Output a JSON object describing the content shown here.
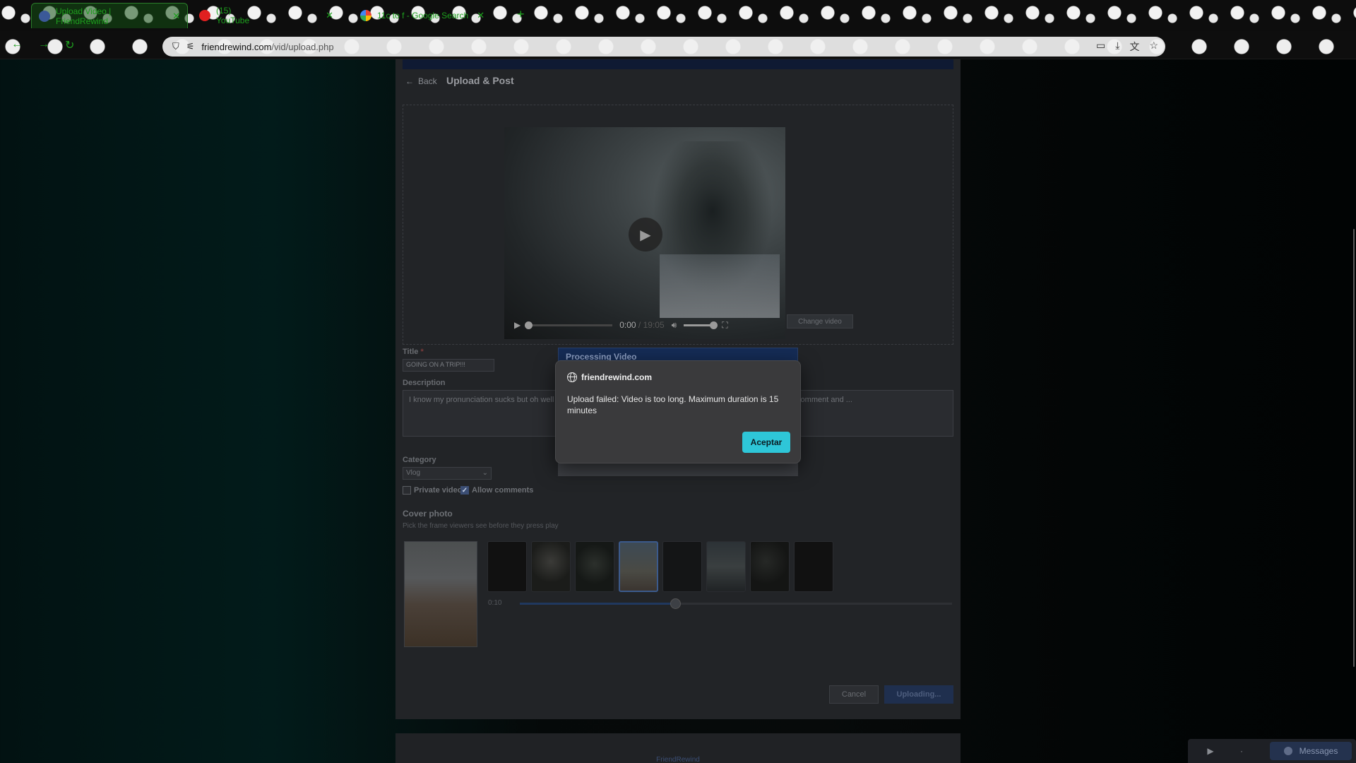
{
  "browser": {
    "tabs": [
      {
        "title": "Upload Video | FriendRewind",
        "active": true
      },
      {
        "title": "(15) YouTube",
        "active": false
      },
      {
        "title": "11c to f - Google Search",
        "active": false
      }
    ],
    "url_host": "friendrewind.com",
    "url_path": "/vid/upload.php",
    "icons": [
      "back-icon",
      "forward-icon",
      "reload-icon",
      "shield-icon",
      "site-settings-icon",
      "cast-icon",
      "download-icon",
      "translate-icon",
      "star-icon"
    ]
  },
  "page": {
    "back_label": "Back",
    "heading": "Upload & Post",
    "video": {
      "current_time": "0:00",
      "separator": " / ",
      "duration": "19:05"
    },
    "change_video_label": "Change video",
    "title_label": "Title",
    "title_required": "*",
    "title_value": "GOING ON A TRIP!!!",
    "description_label": "Description",
    "description_value": "I know my pronunciation sucks but oh well ... on my leg, I know its a boring video but whatever. If u like it leave a comment and ...",
    "category_label": "Category",
    "category_value": "Vlog",
    "private_video_label": "Private video",
    "private_video_checked": false,
    "allow_comments_label": "Allow comments",
    "allow_comments_checked": true,
    "cover_photo_title": "Cover photo",
    "cover_photo_hint": "Pick the frame viewers see before they press play",
    "scrub_time": "0:10",
    "scrub_position": 0.36,
    "cancel_label": "Cancel",
    "upload_label": "Uploading...",
    "footer_text": "FriendRewind"
  },
  "processing_modal": {
    "title": "Processing Video"
  },
  "alert": {
    "origin": "friendrewind.com",
    "message": "Upload failed: Video is too long. Maximum duration is 15 minutes",
    "ok_label": "Aceptar"
  },
  "dock": {
    "messages_label": "Messages"
  },
  "colors": {
    "accent": "#2ec6d8",
    "brand_navy": "#152c56",
    "tab_green": "#1ea01e"
  }
}
